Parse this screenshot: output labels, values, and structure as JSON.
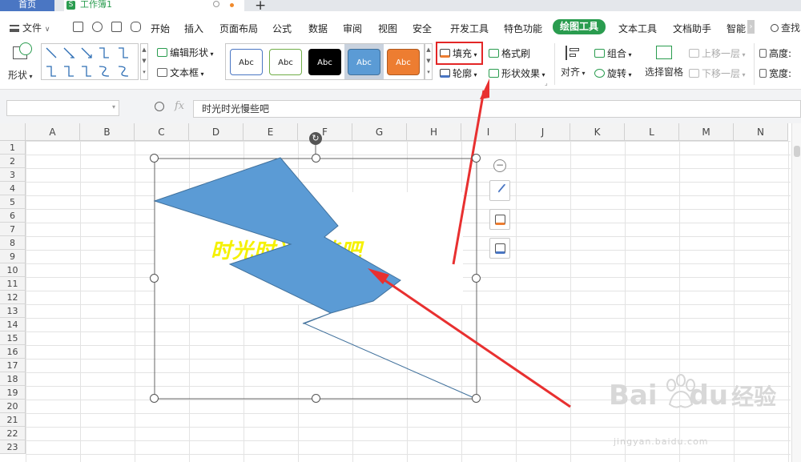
{
  "tabs": {
    "home_label": "首页",
    "doc_label": "工作簿1",
    "doc_icon_letter": "S"
  },
  "menu": {
    "file_label": "文件",
    "items": [
      "开始",
      "插入",
      "页面布局",
      "公式",
      "数据",
      "审阅",
      "视图",
      "安全",
      "开发工具",
      "特色功能",
      "绘图工具",
      "文本工具",
      "文档助手",
      "智能"
    ],
    "active_item": "绘图工具",
    "search_label": "查找"
  },
  "ribbon": {
    "shape_label": "形状",
    "edit_shape_label": "编辑形状",
    "textbox_label": "文本框",
    "style_samples": [
      {
        "text": "Abc",
        "bg": "#ffffff",
        "border": "#4a76c3",
        "color": "#222222"
      },
      {
        "text": "Abc",
        "bg": "#ffffff",
        "border": "#70ad47",
        "color": "#222222"
      },
      {
        "text": "Abc",
        "bg": "#000000",
        "border": "#000000",
        "color": "#ffffff"
      },
      {
        "text": "Abc",
        "bg": "#5b9bd5",
        "border": "#41719c",
        "color": "#ffffff"
      },
      {
        "text": "Abc",
        "bg": "#ed7d31",
        "border": "#ae5a21",
        "color": "#ffffff"
      }
    ],
    "fill_label": "填充",
    "format_painter_label": "格式刷",
    "outline_label": "轮廓",
    "shape_effect_label": "形状效果",
    "align_label": "对齐",
    "group_label": "组合",
    "rotate_label": "旋转",
    "selection_pane_label": "选择窗格",
    "bring_forward_label": "上移一层",
    "send_backward_label": "下移一层",
    "height_label": "高度:",
    "width_label": "宽度:"
  },
  "formula": {
    "name_box_value": "",
    "fx_label": "fx",
    "content": "时光时光慢些吧"
  },
  "sheet": {
    "columns": [
      "A",
      "B",
      "C",
      "D",
      "E",
      "F",
      "G",
      "H",
      "I",
      "J",
      "K",
      "L",
      "M",
      "N"
    ],
    "rows": [
      "1",
      "2",
      "3",
      "4",
      "5",
      "6",
      "7",
      "8",
      "9",
      "10",
      "11",
      "12",
      "13",
      "14",
      "15",
      "16",
      "17",
      "18",
      "19",
      "20",
      "21",
      "22",
      "23"
    ]
  },
  "shape": {
    "wordart_text": "时光时光慢些吧",
    "fill_color": "#5b9bd5",
    "stroke_color": "#41719c",
    "wordart_color": "#f5f100",
    "annotation_color": "#e83030"
  },
  "watermark": {
    "brand": "Bai",
    "brand_cn": "经验",
    "brand_du": "du",
    "url": "jingyan.baidu.com"
  }
}
